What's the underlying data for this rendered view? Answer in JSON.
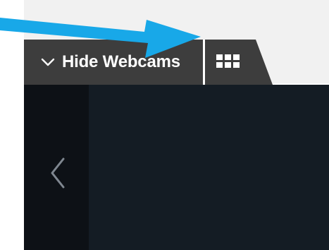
{
  "webcam_tab": {
    "label": "Hide Webcams"
  },
  "icons": {
    "tab_chevron": "chevron-down-icon",
    "grid_view": "grid-icon",
    "back": "chevron-left-icon",
    "annotation": "arrow-annotation"
  },
  "colors": {
    "top_bar": "#f1f1f1",
    "tab_background": "#3d3d3d",
    "dark_panel": "#141c24",
    "left_rail": "#0d1116",
    "annotation_arrow": "#18a8e8"
  }
}
